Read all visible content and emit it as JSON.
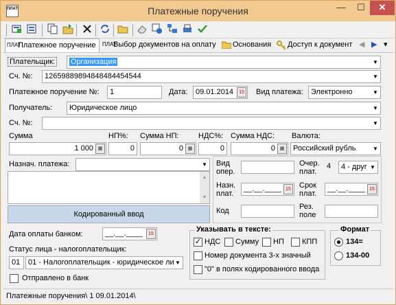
{
  "window": {
    "title": "Платежные поручения",
    "app_icon_text": "ПЛАТ"
  },
  "window_controls": {
    "minimize": "—",
    "maximize": "☐",
    "close": "✕"
  },
  "toolbar": {
    "tools": [
      "add-icon",
      "edit-icon",
      "copy-icon",
      "folder-move-icon",
      "delete-icon",
      "refresh-icon",
      "folder-open-icon",
      "eraser-icon",
      "blue-gear-icon",
      "tree-icon",
      "print-icon",
      "check-icon"
    ]
  },
  "tabs": {
    "items": [
      {
        "label": "Платежное поручение",
        "icon": "ПЛАТ"
      },
      {
        "label": "Выбор документов на оплату",
        "icon": "ПЛАТ"
      },
      {
        "label": "Основания",
        "icon": "folder-icon"
      },
      {
        "label": "Доступ к документ",
        "icon": "key-icon"
      }
    ],
    "nav_prev": "◀",
    "nav_next": "▶",
    "nav_more": "▾"
  },
  "form": {
    "payer_label": "Плательщик:",
    "payer_value": "Организация",
    "account_label": "Сч. №:",
    "account_value": "12659889894848484454544",
    "order_no_label": "Платежное поручение №:",
    "order_no_value": "1",
    "date_label": "Дата:",
    "date_value": "09.01.2014",
    "payment_type_label": "Вид платежа:",
    "payment_type_value": "Электронно",
    "recipient_label": "Получатель:",
    "recipient_value": "Юридическое лицо",
    "recipient_account_label": "Сч. №:",
    "recipient_account_value": "",
    "sum_label": "Сумма",
    "sum_value": "1 000",
    "np_pct_label": "НП%:",
    "np_pct_value": "0",
    "sum_np_label": "Сумма НП:",
    "sum_np_value": "0",
    "nds_pct_label": "НДС%:",
    "nds_pct_value": "0",
    "sum_nds_label": "Сумма НДС:",
    "sum_nds_value": "0",
    "currency_label": "Валюта:",
    "currency_value": "Российский рубль",
    "purpose_label": "Назнач. платежа:",
    "purpose_value": "",
    "coded_input_button": "Кодированный ввод",
    "op_type_label_1": "Вид",
    "op_type_label_2": "опер.",
    "op_type_value": "",
    "queue_label_1": "Очер.",
    "queue_label_2": "плат.",
    "queue_num": "4",
    "queue_value": "4 - друг",
    "purpose_date_label_1": "Назн.",
    "purpose_date_label_2": "плат.",
    "purpose_date_value": "__.__.____",
    "due_date_label_1": "Срок",
    "due_date_label_2": "плат.",
    "due_date_value": "__.__.____",
    "code_label": "Код",
    "code_value": "",
    "result_label_1": "Рез.",
    "result_label_2": "поле",
    "result_value": "",
    "bank_date_label": "Дата оплаты банком:",
    "bank_date_value": "__.__.____",
    "taxpayer_status_label": "Статус лица - налогоплательщик:",
    "taxpayer_status_code": "01",
    "taxpayer_status_value": "01 - Налогоплательщик - юридическое ли",
    "sent_to_bank_label": "Отправлено в банк"
  },
  "indicate_group": {
    "title": "Указывать в тексте:",
    "nds_label": "НДС",
    "nds_checked": true,
    "sum_label": "Сумму",
    "sum_checked": false,
    "np_label": "НП",
    "np_checked": false,
    "kpp_label": "КПП",
    "kpp_checked": false,
    "doc_no_label": "Номер документа 3-х значный",
    "doc_no_checked": false,
    "zero_label": "\"0\" в полях кодированного ввода",
    "zero_checked": false
  },
  "format_group": {
    "title": "Формат",
    "option1": "134=",
    "option1_selected": true,
    "option2": "134-00",
    "option2_selected": false
  },
  "statusbar": {
    "text": "Платежные поручения\\ 1 09.01.2014\\"
  }
}
